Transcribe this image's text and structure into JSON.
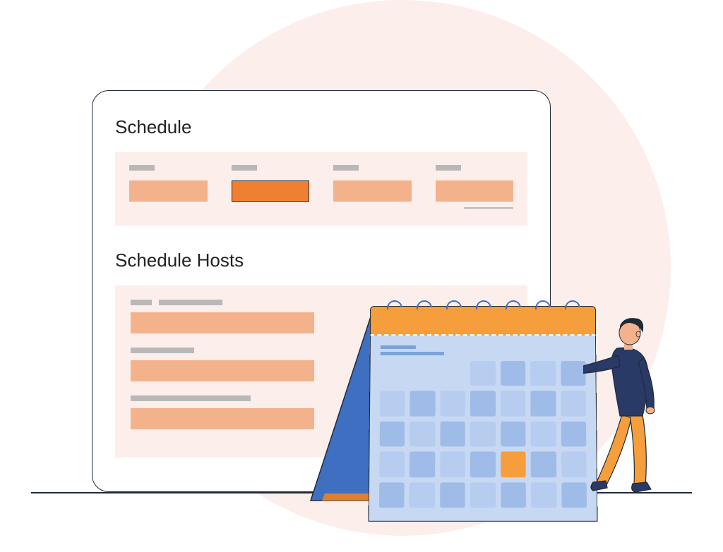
{
  "card": {
    "schedule_title": "Schedule",
    "hosts_title": "Schedule Hosts"
  },
  "colors": {
    "accent_orange": "#ef8033",
    "light_orange": "#f4b28c",
    "panel_bg": "#fceeea",
    "calendar_blue": "#c7d8f3",
    "calendar_header": "#f59e3b"
  }
}
